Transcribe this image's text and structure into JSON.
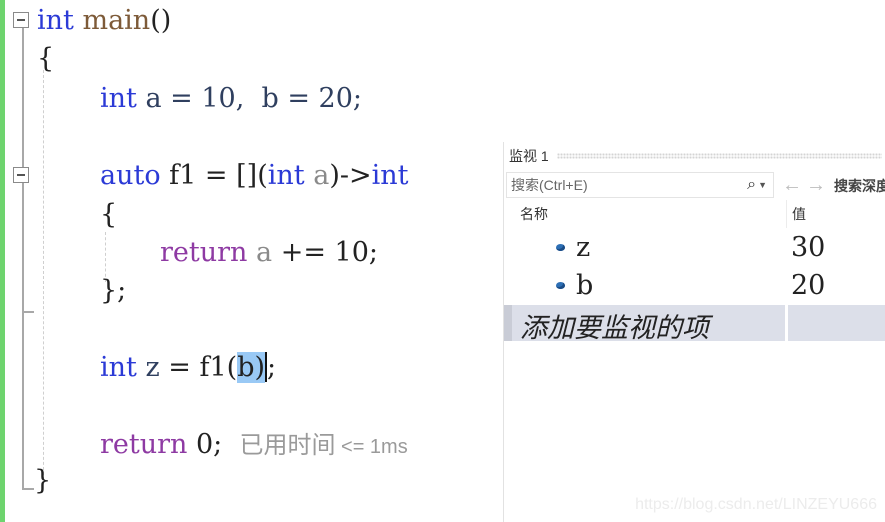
{
  "editor": {
    "lines": {
      "main_sig": {
        "kw": "int",
        "fn": "main",
        "rest": "()"
      },
      "open_main": "{",
      "decl": {
        "kw": "int",
        "text": " a = 10,  b = 20;"
      },
      "lambda": {
        "kw": "auto",
        "mid": " f1 = [](",
        "kw2": "int",
        "param": " a",
        "arrow": ")->",
        "kw3": "int"
      },
      "open_lambda": "{",
      "ret_lambda": {
        "kw": "return",
        "param": " a",
        "rest": " += 10;"
      },
      "close_lambda": "};",
      "call": {
        "kw": "int",
        "var": " z",
        "mid": " = f1(",
        "sel": "b)",
        "end": ";"
      },
      "ret_main": {
        "kw": "return",
        "rest": " 0;"
      },
      "perf_hint": {
        "text": "已用时间",
        "ms": " <= 1ms"
      },
      "close_main": "}"
    }
  },
  "watch_panel": {
    "title": "监视 1",
    "search_placeholder": "搜索(Ctrl+E)",
    "search_icon": "🔍",
    "dropdown_icon": "▼",
    "back_icon": "←",
    "forward_icon": "→",
    "search_depth_label": "搜索深度",
    "columns": {
      "name": "名称",
      "value": "值"
    },
    "rows": [
      {
        "name": "z",
        "value": "30"
      },
      {
        "name": "b",
        "value": "20"
      }
    ],
    "add_item_placeholder": "添加要监视的项"
  },
  "watermark": "https://blog.csdn.net/LINZEYU666",
  "colors": {
    "keyword": "#2b3ad6",
    "control": "#8e3aa3",
    "selection": "#99c9f5",
    "change_bar": "#6ed46e"
  }
}
